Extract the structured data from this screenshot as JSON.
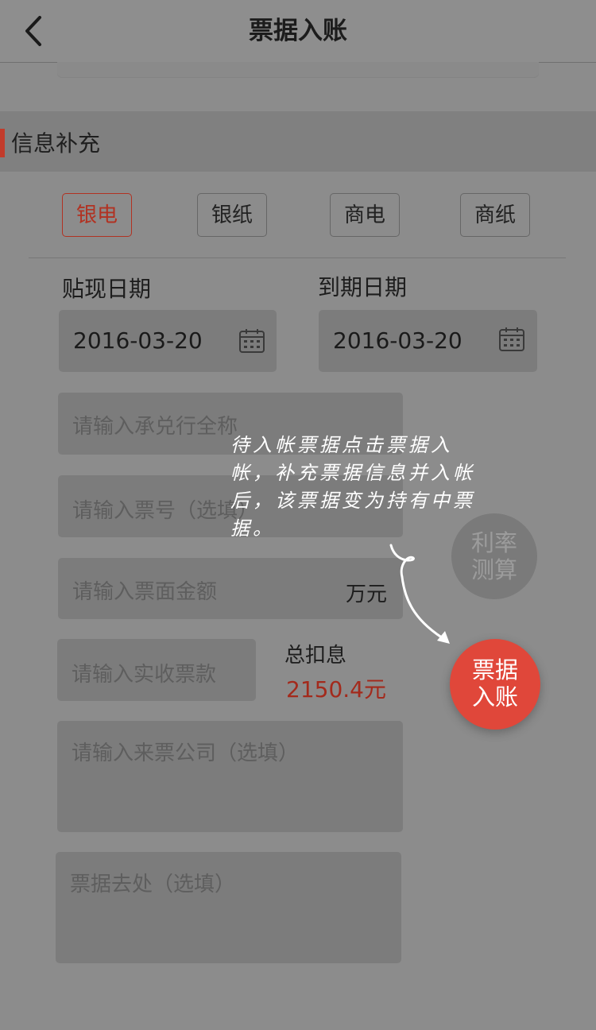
{
  "header": {
    "title": "票据入账"
  },
  "section": {
    "title": "信息补充"
  },
  "bill_types": [
    "银电",
    "银纸",
    "商电",
    "商纸"
  ],
  "selected_bill_type": "银电",
  "dates": {
    "discount_label": "贴现日期",
    "discount_value": "2016-03-20",
    "due_label": "到期日期",
    "due_value": "2016-03-20"
  },
  "inputs": {
    "acceptor_placeholder": "请输入承兑行全称",
    "bill_no_placeholder": "请输入票号（选填）",
    "amount_placeholder": "请输入票面金额",
    "amount_unit": "万元",
    "received_placeholder": "请输入实收票款",
    "source_placeholder": "请输入来票公司（选填）",
    "destination_placeholder": "票据去处（选填）"
  },
  "interest": {
    "label": "总扣息",
    "value": "2150.4元"
  },
  "fab": {
    "rate_line1": "利率",
    "rate_line2": "测算",
    "post_line1": "票据",
    "post_line2": "入账"
  },
  "tooltip": "待入帐票据点击票据入帐，补充票据信息并入帐后，该票据变为持有中票据。",
  "icons": {
    "back": "chevron-left-icon",
    "calendar": "calendar-icon"
  },
  "colors": {
    "accent": "#e0473a",
    "selected": "#b13222",
    "value_red": "#a32a1c"
  }
}
